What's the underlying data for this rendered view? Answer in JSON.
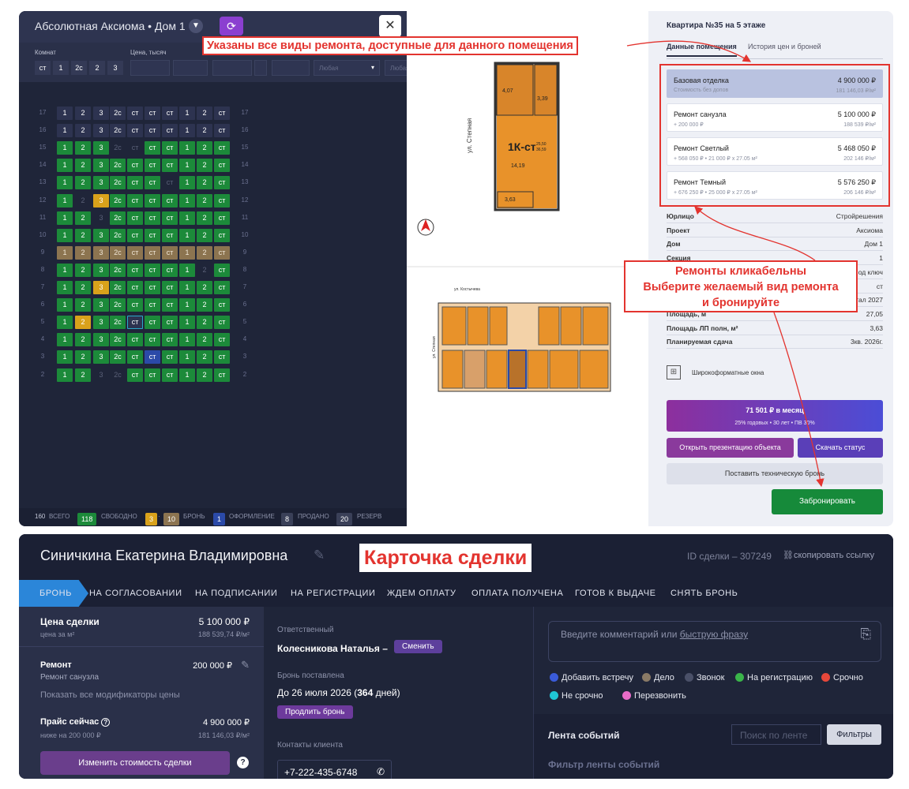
{
  "building": {
    "title": "Абсолютная Аксиома • Дом 1",
    "rooms_label": "Комнат",
    "price_label": "Цена, тысяч",
    "room_types": [
      "ст",
      "1",
      "2с",
      "2",
      "3"
    ],
    "any_label": "Любая",
    "any_label2": "Любая",
    "floors": [
      {
        "n": "17",
        "cells": [
          [
            "1",
            "w"
          ],
          [
            "2",
            "w"
          ],
          [
            "3",
            "w"
          ],
          [
            "2с",
            "w"
          ],
          [
            "ст",
            "w"
          ],
          [
            "ст",
            "w"
          ],
          [
            "ст",
            "w"
          ],
          [
            "1",
            "w"
          ],
          [
            "2",
            "w"
          ],
          [
            "ст",
            "w"
          ]
        ]
      },
      {
        "n": "16",
        "cells": [
          [
            "1",
            "w"
          ],
          [
            "2",
            "w"
          ],
          [
            "3",
            "w"
          ],
          [
            "2с",
            "w"
          ],
          [
            "ст",
            "w"
          ],
          [
            "ст",
            "w"
          ],
          [
            "ст",
            "w"
          ],
          [
            "1",
            "w"
          ],
          [
            "2",
            "w"
          ],
          [
            "ст",
            "w"
          ]
        ]
      },
      {
        "n": "15",
        "cells": [
          [
            "1",
            "g"
          ],
          [
            "2",
            "g"
          ],
          [
            "3",
            "g"
          ],
          [
            "2с",
            "d"
          ],
          [
            "ст",
            "d"
          ],
          [
            "ст",
            "g"
          ],
          [
            "ст",
            "g"
          ],
          [
            "1",
            "g"
          ],
          [
            "2",
            "g"
          ],
          [
            "ст",
            "g"
          ]
        ]
      },
      {
        "n": "14",
        "cells": [
          [
            "1",
            "g"
          ],
          [
            "2",
            "g"
          ],
          [
            "3",
            "g"
          ],
          [
            "2с",
            "g"
          ],
          [
            "ст",
            "g"
          ],
          [
            "ст",
            "g"
          ],
          [
            "ст",
            "g"
          ],
          [
            "1",
            "g"
          ],
          [
            "2",
            "g"
          ],
          [
            "ст",
            "g"
          ]
        ]
      },
      {
        "n": "13",
        "cells": [
          [
            "1",
            "g"
          ],
          [
            "2",
            "g"
          ],
          [
            "3",
            "g"
          ],
          [
            "2с",
            "g"
          ],
          [
            "ст",
            "g"
          ],
          [
            "ст",
            "g"
          ],
          [
            "ст",
            "d"
          ],
          [
            "1",
            "g"
          ],
          [
            "2",
            "g"
          ],
          [
            "ст",
            "g"
          ]
        ]
      },
      {
        "n": "12",
        "cells": [
          [
            "1",
            "g"
          ],
          [
            "2",
            "d"
          ],
          [
            "3",
            "y"
          ],
          [
            "2с",
            "g"
          ],
          [
            "ст",
            "g"
          ],
          [
            "ст",
            "g"
          ],
          [
            "ст",
            "g"
          ],
          [
            "1",
            "g"
          ],
          [
            "2",
            "g"
          ],
          [
            "ст",
            "g"
          ]
        ]
      },
      {
        "n": "11",
        "cells": [
          [
            "1",
            "g"
          ],
          [
            "2",
            "g"
          ],
          [
            "3",
            "d"
          ],
          [
            "2с",
            "g"
          ],
          [
            "ст",
            "g"
          ],
          [
            "ст",
            "g"
          ],
          [
            "ст",
            "g"
          ],
          [
            "1",
            "g"
          ],
          [
            "2",
            "g"
          ],
          [
            "ст",
            "g"
          ]
        ]
      },
      {
        "n": "10",
        "cells": [
          [
            "1",
            "g"
          ],
          [
            "2",
            "g"
          ],
          [
            "3",
            "g"
          ],
          [
            "2с",
            "g"
          ],
          [
            "ст",
            "g"
          ],
          [
            "ст",
            "g"
          ],
          [
            "ст",
            "g"
          ],
          [
            "1",
            "g"
          ],
          [
            "2",
            "g"
          ],
          [
            "ст",
            "g"
          ]
        ]
      },
      {
        "n": "9",
        "cells": [
          [
            "1",
            "t"
          ],
          [
            "2",
            "t"
          ],
          [
            "3",
            "t"
          ],
          [
            "2с",
            "t"
          ],
          [
            "ст",
            "t"
          ],
          [
            "ст",
            "t"
          ],
          [
            "ст",
            "t"
          ],
          [
            "1",
            "t"
          ],
          [
            "2",
            "t"
          ],
          [
            "ст",
            "t"
          ]
        ]
      },
      {
        "n": "8",
        "cells": [
          [
            "1",
            "g"
          ],
          [
            "2",
            "g"
          ],
          [
            "3",
            "g"
          ],
          [
            "2с",
            "g"
          ],
          [
            "ст",
            "g"
          ],
          [
            "ст",
            "g"
          ],
          [
            "ст",
            "g"
          ],
          [
            "1",
            "g"
          ],
          [
            "2",
            "d"
          ],
          [
            "ст",
            "g"
          ]
        ]
      },
      {
        "n": "7",
        "cells": [
          [
            "1",
            "g"
          ],
          [
            "2",
            "g"
          ],
          [
            "3",
            "y"
          ],
          [
            "2с",
            "g"
          ],
          [
            "ст",
            "g"
          ],
          [
            "ст",
            "g"
          ],
          [
            "ст",
            "g"
          ],
          [
            "1",
            "g"
          ],
          [
            "2",
            "g"
          ],
          [
            "ст",
            "g"
          ]
        ]
      },
      {
        "n": "6",
        "cells": [
          [
            "1",
            "g"
          ],
          [
            "2",
            "g"
          ],
          [
            "3",
            "g"
          ],
          [
            "2с",
            "g"
          ],
          [
            "ст",
            "g"
          ],
          [
            "ст",
            "g"
          ],
          [
            "ст",
            "g"
          ],
          [
            "1",
            "g"
          ],
          [
            "2",
            "g"
          ],
          [
            "ст",
            "g"
          ]
        ]
      },
      {
        "n": "5",
        "cells": [
          [
            "1",
            "g"
          ],
          [
            "2",
            "y"
          ],
          [
            "3",
            "g"
          ],
          [
            "2с",
            "g"
          ],
          [
            "ст",
            "s"
          ],
          [
            "ст",
            "g"
          ],
          [
            "ст",
            "g"
          ],
          [
            "1",
            "g"
          ],
          [
            "2",
            "g"
          ],
          [
            "ст",
            "g"
          ]
        ]
      },
      {
        "n": "4",
        "cells": [
          [
            "1",
            "g"
          ],
          [
            "2",
            "g"
          ],
          [
            "3",
            "g"
          ],
          [
            "2с",
            "g"
          ],
          [
            "ст",
            "g"
          ],
          [
            "ст",
            "g"
          ],
          [
            "ст",
            "g"
          ],
          [
            "1",
            "g"
          ],
          [
            "2",
            "g"
          ],
          [
            "ст",
            "g"
          ]
        ]
      },
      {
        "n": "3",
        "cells": [
          [
            "1",
            "g"
          ],
          [
            "2",
            "g"
          ],
          [
            "3",
            "g"
          ],
          [
            "2с",
            "g"
          ],
          [
            "ст",
            "g"
          ],
          [
            "ст",
            "b"
          ],
          [
            "ст",
            "g"
          ],
          [
            "1",
            "g"
          ],
          [
            "2",
            "g"
          ],
          [
            "ст",
            "g"
          ]
        ]
      },
      {
        "n": "2",
        "cells": [
          [
            "1",
            "g"
          ],
          [
            "2",
            "g"
          ],
          [
            "3",
            "d"
          ],
          [
            "2с",
            "d"
          ],
          [
            "ст",
            "g"
          ],
          [
            "ст",
            "g"
          ],
          [
            "ст",
            "g"
          ],
          [
            "1",
            "g"
          ],
          [
            "2",
            "g"
          ],
          [
            "ст",
            "g"
          ]
        ]
      }
    ],
    "stats": {
      "total": "160",
      "total_label": "ВСЕГО",
      "free": "118",
      "free_label": "СВОБОДНО",
      "booked_a": "3",
      "booked_b": "10",
      "booked_label": "БРОНЬ",
      "processing": "1",
      "processing_label": "ОФОРМЛЕНИЕ",
      "sold": "8",
      "sold_label": "ПРОДАНО",
      "reserve": "20",
      "reserve_label": "РЕЗЕРВ"
    }
  },
  "plan": {
    "street_top": "ул. Степная",
    "type": "1К-ст",
    "area_a": "25,50",
    "area_b": "36,59",
    "room_a": "4,07",
    "room_b": "3,39",
    "room_c": "14,19",
    "room_d": "3,63",
    "floor_street": "ул. Костычева",
    "floor_street2": "ул. Степная"
  },
  "apartment": {
    "title": "Квартира №35 на 5 этаже",
    "tabs": [
      "Данные помещения",
      "История цен и броней"
    ],
    "options": [
      {
        "name": "Базовая отделка",
        "price": "4 900 000 ₽",
        "sub": "Стоимость без допов",
        "unit": "181 146,03 ₽/м²"
      },
      {
        "name": "Ремонт санузла",
        "price": "5 100 000 ₽",
        "sub": "+ 200 000 ₽",
        "unit": "188 539 ₽/м²"
      },
      {
        "name": "Ремонт Светлый",
        "price": "5 468 050 ₽",
        "sub": "+ 568 050 ₽ • 21 000 ₽ x 27.05 м²",
        "unit": "202 146 ₽/м²"
      },
      {
        "name": "Ремонт Темный",
        "price": "5 576 250 ₽",
        "sub": "+ 676 250 ₽ • 25 000 ₽ x 27.05 м²",
        "unit": "206 146 ₽/м²"
      }
    ],
    "props": [
      [
        "Юрлицо",
        "Стройрешения"
      ],
      [
        "Проект",
        "Аксиома"
      ],
      [
        "Дом",
        "Дом 1"
      ],
      [
        "Секция",
        "1"
      ],
      [
        "",
        "од ключ"
      ],
      [
        "",
        "ст"
      ],
      [
        "",
        "тал 2027"
      ],
      [
        "Площадь, м",
        "27,05"
      ],
      [
        "Площадь ЛП полн, м²",
        "3,63"
      ],
      [
        "Планируемая сдача",
        "3кв. 2026г."
      ]
    ],
    "window": "Широкоформатные окна",
    "mortgage": "71 501 ₽ в месяц",
    "mortgage_sub": "25% годовых • 30 лет • ПВ 30%",
    "btn_present": "Открыть презентацию объекта",
    "btn_status": "Скачать статус",
    "btn_tech": "Поставить техническую бронь",
    "btn_book": "Забронировать"
  },
  "annotations": {
    "a1": "Указаны все виды ремонта, доступные для данного помещения",
    "a2_1": "Ремонты кликабельны",
    "a2_2": "Выберите желаемый вид ремонта",
    "a2_3": "и бронируйте",
    "card": "Карточка сделки"
  },
  "deal": {
    "client": "Синичкина Екатерина Владимировна",
    "id": "ID сделки – 307249",
    "copy": "скопировать ссылку",
    "stages": [
      "БРОНЬ",
      "НА СОГЛАСОВАНИИ",
      "НА ПОДПИСАНИИ",
      "НА РЕГИСТРАЦИИ",
      "ЖДЕМ ОПЛАТУ",
      "ОПЛАТА ПОЛУЧЕНА",
      "ГОТОВ К ВЫДАЧЕ",
      "СНЯТЬ БРОНЬ"
    ],
    "price_label": "Цена сделки",
    "price": "5 100 000 ₽",
    "price_sqm_label": "цена за м²",
    "price_sqm": "188 539,74 ₽/м²",
    "repair_label": "Ремонт",
    "repair_value": "200 000 ₽",
    "repair_type": "Ремонт санузла",
    "show_mods": "Показать все модификаторы цены",
    "list_label": "Прайс сейчас",
    "list_price": "4 900 000 ₽",
    "list_below": "ниже на 200 000 ₽",
    "list_sqm": "181 146,03 ₽/м²",
    "change_btn": "Изменить стоимость сделки",
    "responsible_label": "Ответственный",
    "responsible": "Колесникова Наталья –",
    "change_resp": "Сменить",
    "booked_label": "Бронь поставлена",
    "booked_until": "До 26 июля 2026 (",
    "booked_days": "364",
    "booked_tail": " дней)",
    "extend": "Продлить бронь",
    "contacts_label": "Контакты клиента",
    "phone": "+7-222-435-6748",
    "comment_placeholder": "Введите комментарий или ",
    "quick_phrase": "быструю фразу",
    "chips": [
      {
        "label": "Добавить встречу",
        "color": "#3a5bd9"
      },
      {
        "label": "Дело",
        "color": "#8a7a66"
      },
      {
        "label": "Звонок",
        "color": "#4a5068"
      },
      {
        "label": "На регистрацию",
        "color": "#3ab54a"
      },
      {
        "label": "Срочно",
        "color": "#e6473a"
      },
      {
        "label": "Не срочно",
        "color": "#1fc6d6"
      },
      {
        "label": "Перезвонить",
        "color": "#e86cc8"
      }
    ],
    "feed_title": "Лента событий",
    "feed_search": "Поиск по ленте",
    "filters": "Фильтры",
    "feed_filter": "Фильтр ленты событий"
  }
}
